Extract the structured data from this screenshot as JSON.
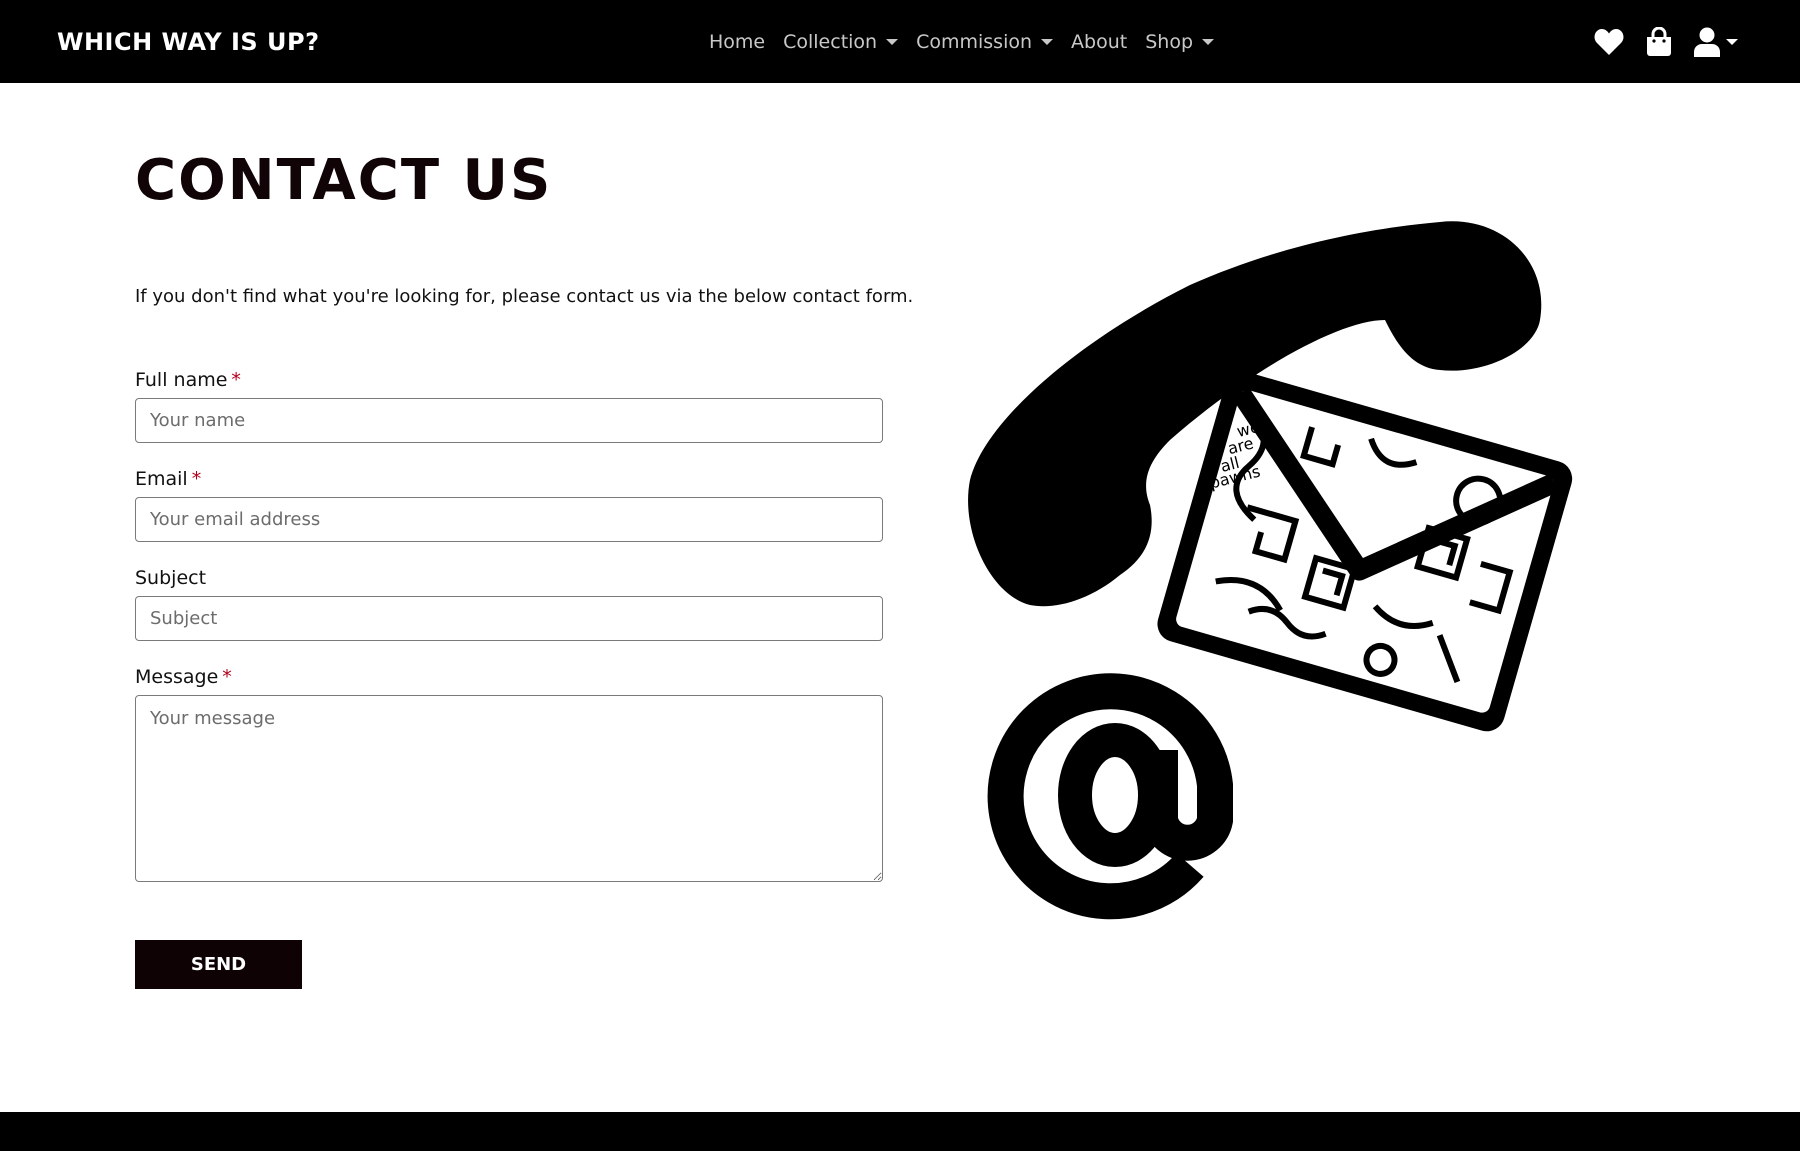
{
  "navbar": {
    "brand": "WHICH WAY IS UP?",
    "links": [
      {
        "label": "Home",
        "dropdown": false
      },
      {
        "label": "Collection",
        "dropdown": true
      },
      {
        "label": "Commission",
        "dropdown": true
      },
      {
        "label": "About",
        "dropdown": false
      },
      {
        "label": "Shop",
        "dropdown": true
      }
    ],
    "icons": [
      "heart-icon",
      "shopping-bag-icon",
      "user-icon"
    ]
  },
  "main": {
    "title": "CONTACT US",
    "intro": "If you don't find what you're looking for, please contact us via the below contact form."
  },
  "form": {
    "full_name": {
      "label": "Full name",
      "required_mark": "*",
      "placeholder": "Your name"
    },
    "email": {
      "label": "Email",
      "required_mark": "*",
      "placeholder": "Your email address"
    },
    "subject": {
      "label": "Subject",
      "placeholder": "Subject"
    },
    "message": {
      "label": "Message",
      "required_mark": "*",
      "placeholder": "Your message"
    },
    "send_label": "SEND"
  },
  "illustration": {
    "icons": [
      "phone-handset-icon",
      "envelope-icon",
      "at-sign-icon"
    ],
    "doodle_text": [
      "we",
      "are",
      "all",
      "pawns"
    ]
  },
  "colors": {
    "navbar_bg": "#000000",
    "nav_link": "#c8c8c8",
    "required": "#b0001b",
    "button_bg": "#0f0205"
  }
}
